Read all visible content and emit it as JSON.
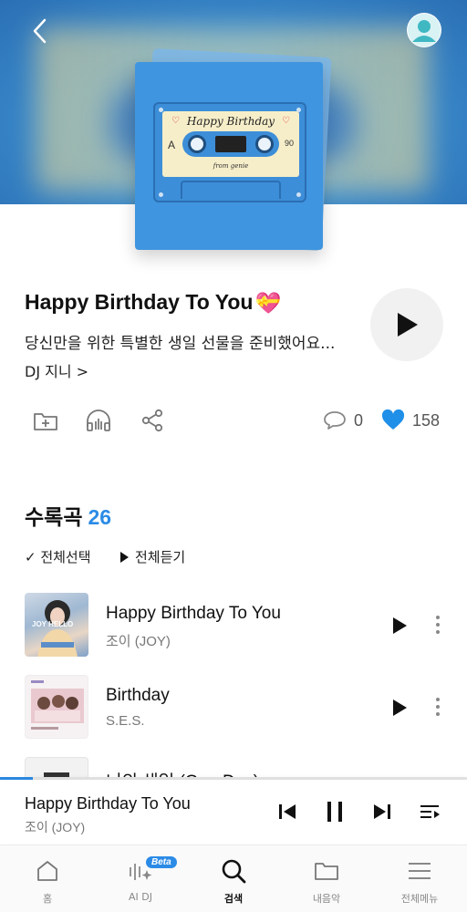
{
  "header": {
    "back_icon": "chevron-left-icon",
    "profile_icon": "user-avatar-icon"
  },
  "album_art": {
    "cassette_title": "Happy Birthday",
    "cassette_side": "A",
    "cassette_length": "90",
    "cassette_from": "from genie"
  },
  "playlist": {
    "title": "Happy Birthday To You",
    "title_emoji": "💝",
    "description": "당신만을 위한 특별한 생일 선물을 준비했어요...",
    "dj": "DJ 지니 >",
    "comment_count": "0",
    "like_count": "158"
  },
  "tracklist": {
    "heading": "수록곡",
    "count": "26",
    "select_all": "✓  전체선택",
    "play_all": "전체듣기",
    "tracks": [
      {
        "name": "Happy Birthday To You",
        "artist": "조이 (JOY)",
        "thumb_text": "JOY HELLO"
      },
      {
        "name": "Birthday",
        "artist": "S.E.S.",
        "thumb_text": ""
      },
      {
        "name": "너의 생일 (One Day)",
        "artist": "",
        "thumb_text": ""
      }
    ]
  },
  "mini_player": {
    "title": "Happy Birthday To You",
    "artist": "조이 (JOY)",
    "progress": 0.07
  },
  "bottom_nav": {
    "items": [
      {
        "label": "홈",
        "icon": "home-icon"
      },
      {
        "label": "AI DJ",
        "icon": "ai-dj-icon",
        "badge": "Beta"
      },
      {
        "label": "검색",
        "icon": "search-icon",
        "active": true
      },
      {
        "label": "내음악",
        "icon": "folder-icon"
      },
      {
        "label": "전체메뉴",
        "icon": "menu-icon"
      }
    ]
  },
  "colors": {
    "accent": "#2b8be6",
    "hero_blue": "#3d8fd0",
    "heart": "#1f8fe8"
  }
}
